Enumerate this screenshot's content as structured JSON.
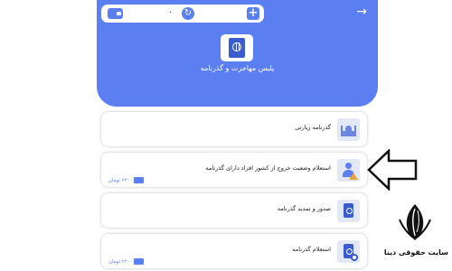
{
  "header": {
    "title": "پلیس مهاجرت و گذرنامه",
    "balance": "۰",
    "back_icon": "arrow-right-icon",
    "color": "#5b7ef0"
  },
  "services": [
    {
      "title": "گذرنامه زیارتی",
      "icon": "mosque-icon",
      "price": ""
    },
    {
      "title": "استعلام وضعیت خروج از کشور افراد دارای گذرنامه",
      "icon": "person-warning-icon",
      "price": "۲۲۰۰ تومان"
    },
    {
      "title": "صدور و تمدید گذرنامه",
      "icon": "passport-icon",
      "price": ""
    },
    {
      "title": "استعلام گذرنامه",
      "icon": "passport-search-icon",
      "price": "۲۲۰۰ تومان"
    }
  ],
  "watermark": {
    "text": "سایت حقوقی دینا"
  }
}
